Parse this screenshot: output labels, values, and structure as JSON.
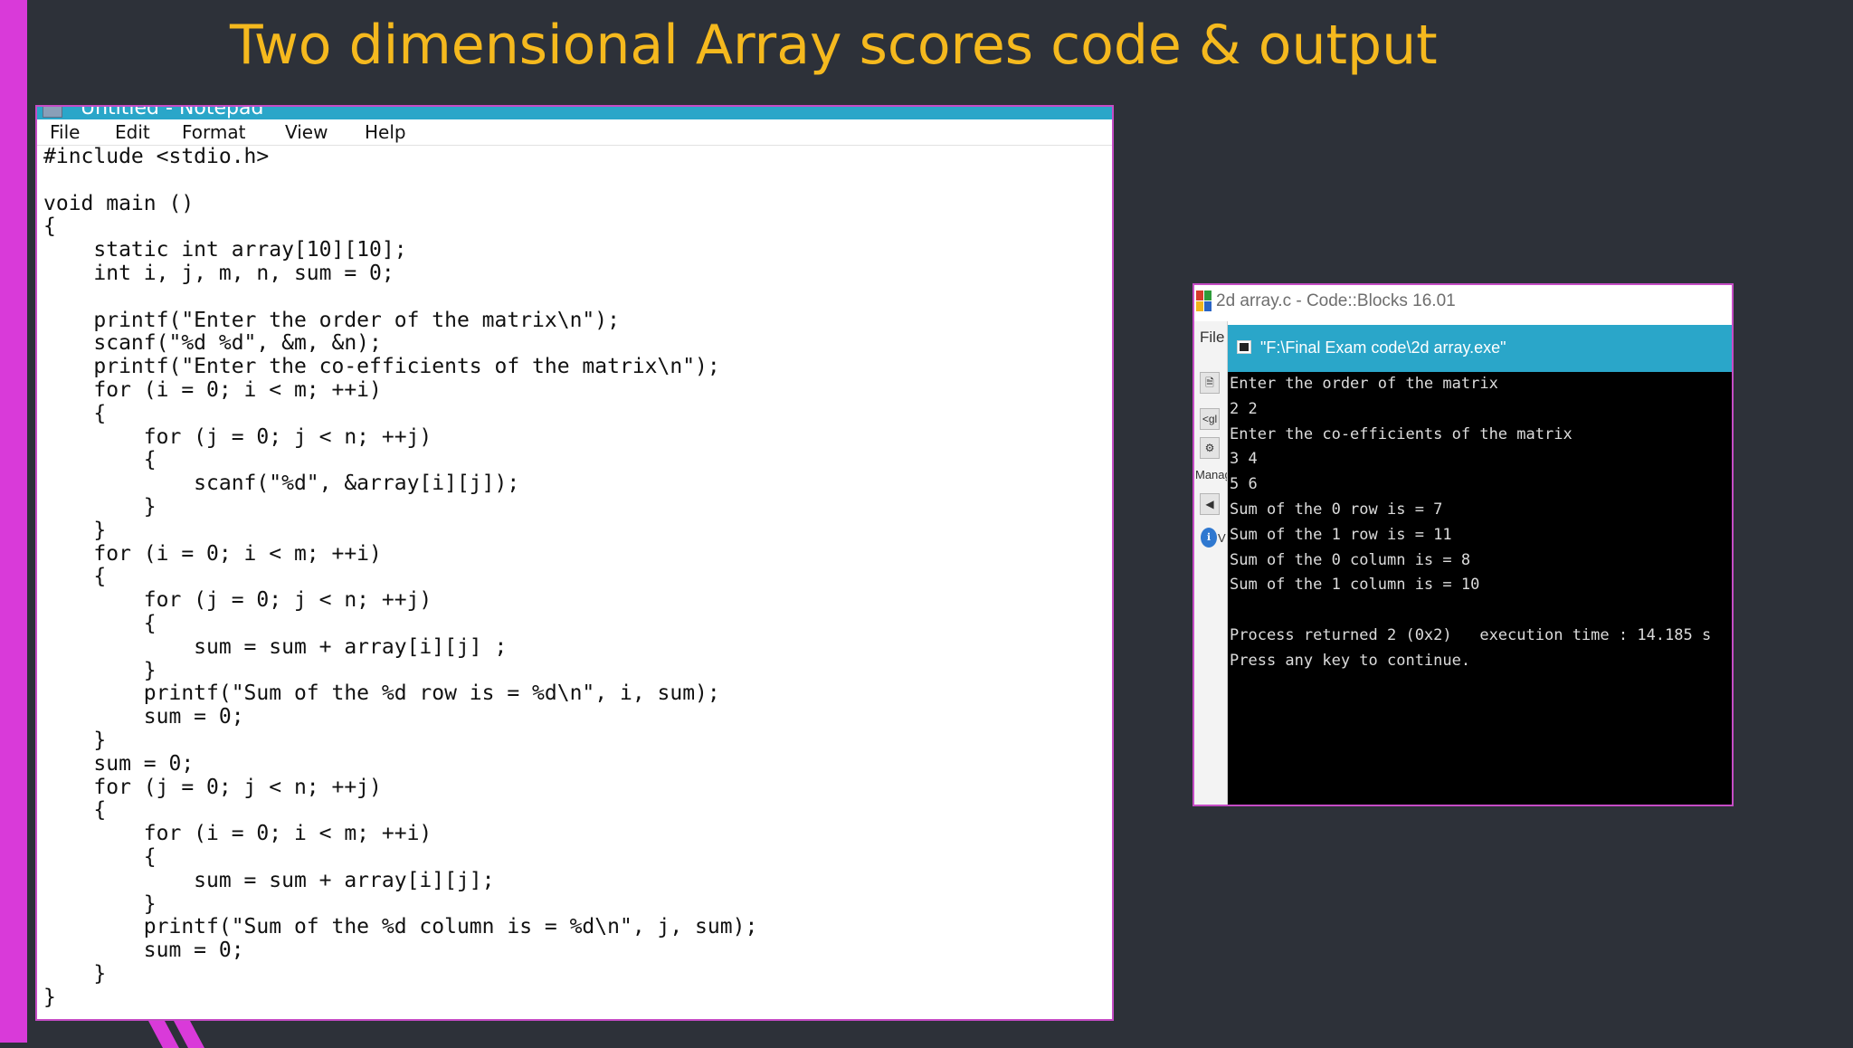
{
  "slide": {
    "title": "Two dimensional Array scores code & output",
    "accent_color": "#d93ad9",
    "title_color": "#f5b91e",
    "background_color": "#2d3139"
  },
  "notepad": {
    "window_title": "Untitled - Notepad",
    "icon": "notepad-icon",
    "menu": [
      "File",
      "Edit",
      "Format",
      "View",
      "Help"
    ],
    "code": "#include <stdio.h>\n\nvoid main ()\n{\n    static int array[10][10];\n    int i, j, m, n, sum = 0;\n\n    printf(\"Enter the order of the matrix\\n\");\n    scanf(\"%d %d\", &m, &n);\n    printf(\"Enter the co-efficients of the matrix\\n\");\n    for (i = 0; i < m; ++i)\n    {\n        for (j = 0; j < n; ++j)\n        {\n            scanf(\"%d\", &array[i][j]);\n        }\n    }\n    for (i = 0; i < m; ++i)\n    {\n        for (j = 0; j < n; ++j)\n        {\n            sum = sum + array[i][j] ;\n        }\n        printf(\"Sum of the %d row is = %d\\n\", i, sum);\n        sum = 0;\n    }\n    sum = 0;\n    for (j = 0; j < n; ++j)\n    {\n        for (i = 0; i < m; ++i)\n        {\n            sum = sum + array[i][j];\n        }\n        printf(\"Sum of the %d column is = %d\\n\", j, sum);\n        sum = 0;\n    }\n}"
  },
  "codeblocks": {
    "window_title": "2d array.c - Code::Blocks 16.01",
    "icon": "codeblocks-logo-icon",
    "sidebar": {
      "file_menu": "File",
      "icon1_glyph": "🗎",
      "icon2_glyph": "<gl",
      "icon3_glyph": "⚙",
      "manager_label": "Manag",
      "arrow_glyph": "◀",
      "info_glyph": "ℹ",
      "info_label": "V"
    },
    "console": {
      "window_title": "\"F:\\Final Exam code\\2d array.exe\"",
      "icon": "console-window-icon",
      "output": "Enter the order of the matrix\n2 2\nEnter the co-efficients of the matrix\n3 4\n5 6\nSum of the 0 row is = 7\nSum of the 1 row is = 11\nSum of the 0 column is = 8\nSum of the 1 column is = 10\n\nProcess returned 2 (0x2)   execution time : 14.185 s\nPress any key to continue."
    }
  }
}
